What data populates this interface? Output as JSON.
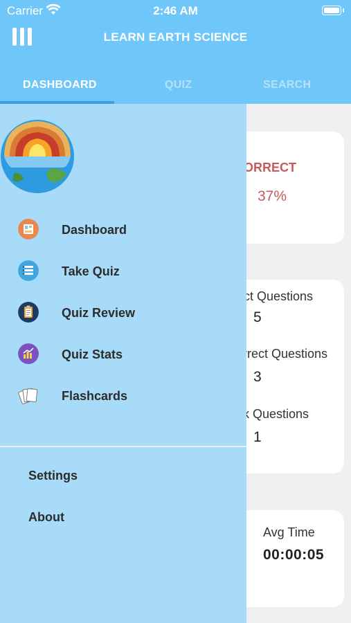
{
  "status_bar": {
    "carrier": "Carrier",
    "time": "2:46 AM"
  },
  "header": {
    "title": "LEARN EARTH SCIENCE"
  },
  "tabs": [
    {
      "label": "DASHBOARD",
      "active": true
    },
    {
      "label": "QUIZ",
      "active": false
    },
    {
      "label": "SEARCH",
      "active": false
    }
  ],
  "dashboard": {
    "incorrect": {
      "label": "ICORRECT",
      "value": "37%"
    },
    "questions": [
      {
        "label": "ect Questions",
        "value": "5"
      },
      {
        "label": "rrect Questions",
        "value": "3"
      },
      {
        "label": "k Questions",
        "value": "1"
      }
    ],
    "avg_time": {
      "label": "Avg Time",
      "value": "00:00:05"
    }
  },
  "drawer": {
    "items": [
      {
        "label": "Dashboard",
        "icon": "dashboard-icon",
        "color": "#e9874f"
      },
      {
        "label": "Take Quiz",
        "icon": "take-quiz-icon",
        "color": "#43a6e2"
      },
      {
        "label": "Quiz Review",
        "icon": "clipboard-icon",
        "color": "#1f3a63"
      },
      {
        "label": "Quiz Stats",
        "icon": "stats-chart-icon",
        "color": "#7c52bf"
      },
      {
        "label": "Flashcards",
        "icon": "flashcards-icon",
        "color": "#ffffff"
      }
    ],
    "footer": [
      {
        "label": "Settings"
      },
      {
        "label": "About"
      }
    ]
  },
  "colors": {
    "header": "#6ec6f9",
    "drawer": "#a7dbf8",
    "incorrect": "#c65a5a",
    "tab_indicator": "#3a9fe0"
  }
}
